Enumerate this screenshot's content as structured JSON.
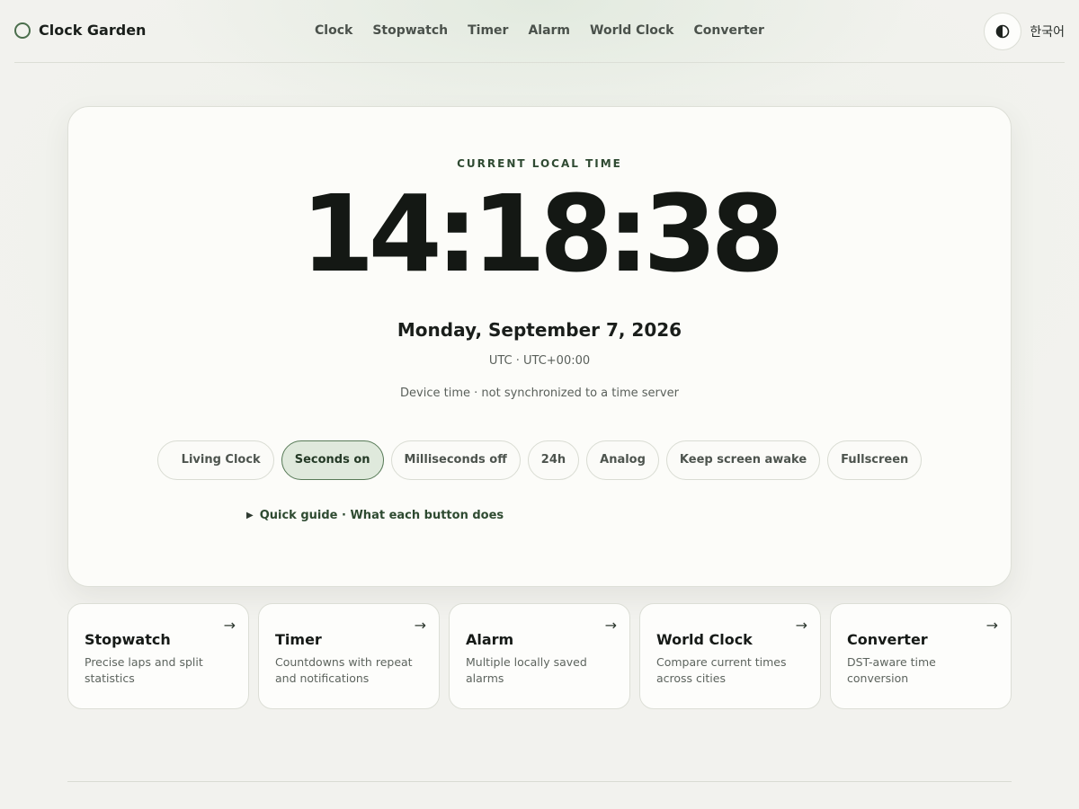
{
  "header": {
    "brand": "Clock Garden",
    "nav": [
      "Clock",
      "Stopwatch",
      "Timer",
      "Alarm",
      "World Clock",
      "Converter"
    ],
    "theme_toggle_icon": "contrast-icon",
    "language": "한국어"
  },
  "clock": {
    "eyebrow": "CURRENT LOCAL TIME",
    "time": "14:18:38",
    "date": "Monday, September 7, 2026",
    "timezone": "UTC · UTC+00:00",
    "sync_note": "Device time · not synchronized to a time server"
  },
  "controls": [
    {
      "label": "Living Clock",
      "active": false
    },
    {
      "label": "Seconds on",
      "active": true
    },
    {
      "label": "Milliseconds off",
      "active": false
    },
    {
      "label": "24h",
      "active": false
    },
    {
      "label": "Analog",
      "active": false
    },
    {
      "label": "Keep screen awake",
      "active": false
    },
    {
      "label": "Fullscreen",
      "active": false
    }
  ],
  "guide": {
    "label": "Quick guide · What each button does"
  },
  "features": [
    {
      "title": "Stopwatch",
      "desc": "Precise laps and split statistics",
      "arrow": "→"
    },
    {
      "title": "Timer",
      "desc": "Countdowns with repeat and notifications",
      "arrow": "→"
    },
    {
      "title": "Alarm",
      "desc": "Multiple locally saved alarms",
      "arrow": "→"
    },
    {
      "title": "World Clock",
      "desc": "Compare current times across cities",
      "arrow": "→"
    },
    {
      "title": "Converter",
      "desc": "DST-aware time conversion",
      "arrow": "→"
    }
  ],
  "colors": {
    "accent": "#4b6e4c",
    "active_pill_bg": "#dfe9dc",
    "page_bg": "#f2f2ee"
  }
}
